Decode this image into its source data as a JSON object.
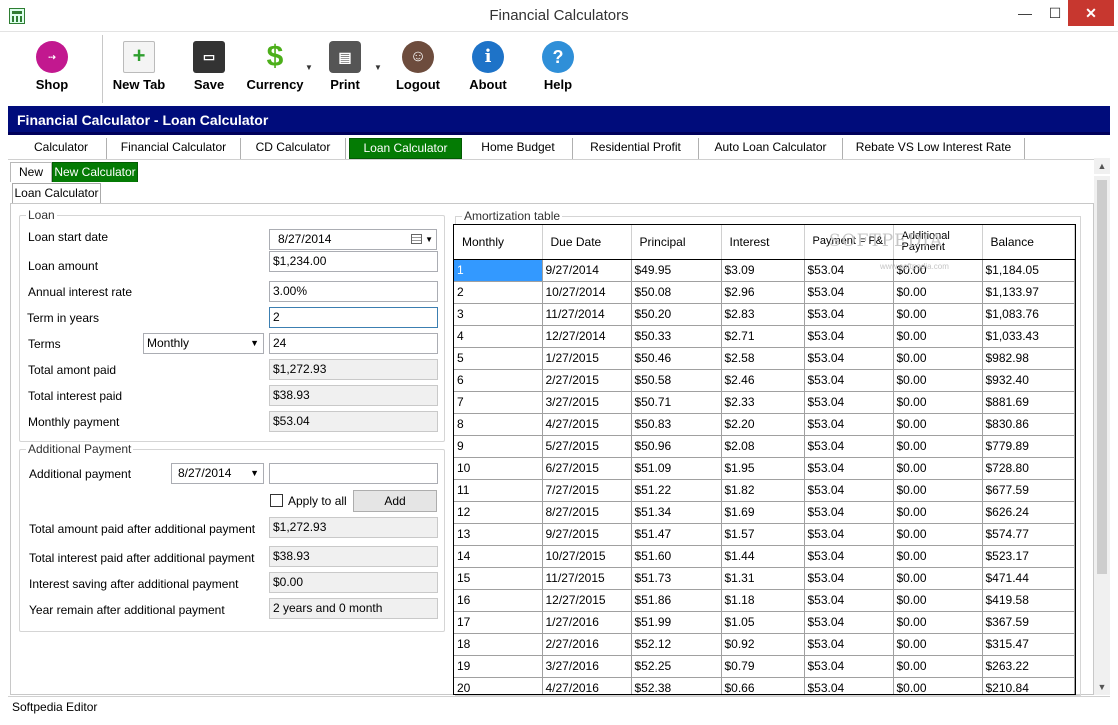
{
  "window": {
    "title": "Financial Calculators"
  },
  "toolbar": {
    "shop": "Shop",
    "new_tab": "New Tab",
    "save": "Save",
    "currency": "Currency",
    "print": "Print",
    "logout": "Logout",
    "about": "About",
    "help": "Help"
  },
  "header": {
    "title": "Financial Calculator - Loan Calculator"
  },
  "tabs": [
    "Calculator",
    "Financial Calculator",
    "CD Calculator",
    "Loan Calculator",
    "Home Budget",
    "Residential Profit",
    "Auto Loan Calculator",
    "Rebate VS Low Interest Rate"
  ],
  "subtabs": [
    "New",
    "New Calculator"
  ],
  "inner_tab": "Loan Calculator",
  "loan": {
    "legend": "Loan",
    "start_date_label": "Loan start date",
    "start_date": "8/27/2014",
    "amount_label": "Loan amount",
    "amount": "$1,234.00",
    "rate_label": "Annual interest rate",
    "rate": "3.00%",
    "term_label": "Term in years",
    "term": "2",
    "terms_label": "Terms",
    "terms_select": "Monthly",
    "terms_value": "24",
    "total_paid_label": "Total amont paid",
    "total_paid": "$1,272.93",
    "total_interest_label": "Total interest paid",
    "total_interest": "$38.93",
    "monthly_label": "Monthly payment",
    "monthly": "$53.04"
  },
  "additional": {
    "legend": "Additional Payment",
    "payment_label": "Additional payment",
    "date": "8/27/2014",
    "amount": "",
    "apply_all": "Apply to all",
    "add_button": "Add",
    "total_paid_label": "Total amount paid after additional payment",
    "total_paid": "$1,272.93",
    "total_interest_label": "Total interest paid after additional payment",
    "total_interest": "$38.93",
    "saving_label": "Interest saving after additional payment",
    "saving": "$0.00",
    "remain_label": "Year remain after additional payment",
    "remain": "2 years and 0 month"
  },
  "amortization": {
    "legend": "Amortization table",
    "columns": [
      "Monthly",
      "Due Date",
      "Principal",
      "Interest",
      "Payment = P&I",
      "Additional Payment",
      "Balance"
    ],
    "rows": [
      [
        "1",
        "9/27/2014",
        "$49.95",
        "$3.09",
        "$53.04",
        "$0.00",
        "$1,184.05"
      ],
      [
        "2",
        "10/27/2014",
        "$50.08",
        "$2.96",
        "$53.04",
        "$0.00",
        "$1,133.97"
      ],
      [
        "3",
        "11/27/2014",
        "$50.20",
        "$2.83",
        "$53.04",
        "$0.00",
        "$1,083.76"
      ],
      [
        "4",
        "12/27/2014",
        "$50.33",
        "$2.71",
        "$53.04",
        "$0.00",
        "$1,033.43"
      ],
      [
        "5",
        "1/27/2015",
        "$50.46",
        "$2.58",
        "$53.04",
        "$0.00",
        "$982.98"
      ],
      [
        "6",
        "2/27/2015",
        "$50.58",
        "$2.46",
        "$53.04",
        "$0.00",
        "$932.40"
      ],
      [
        "7",
        "3/27/2015",
        "$50.71",
        "$2.33",
        "$53.04",
        "$0.00",
        "$881.69"
      ],
      [
        "8",
        "4/27/2015",
        "$50.83",
        "$2.20",
        "$53.04",
        "$0.00",
        "$830.86"
      ],
      [
        "9",
        "5/27/2015",
        "$50.96",
        "$2.08",
        "$53.04",
        "$0.00",
        "$779.89"
      ],
      [
        "10",
        "6/27/2015",
        "$51.09",
        "$1.95",
        "$53.04",
        "$0.00",
        "$728.80"
      ],
      [
        "11",
        "7/27/2015",
        "$51.22",
        "$1.82",
        "$53.04",
        "$0.00",
        "$677.59"
      ],
      [
        "12",
        "8/27/2015",
        "$51.34",
        "$1.69",
        "$53.04",
        "$0.00",
        "$626.24"
      ],
      [
        "13",
        "9/27/2015",
        "$51.47",
        "$1.57",
        "$53.04",
        "$0.00",
        "$574.77"
      ],
      [
        "14",
        "10/27/2015",
        "$51.60",
        "$1.44",
        "$53.04",
        "$0.00",
        "$523.17"
      ],
      [
        "15",
        "11/27/2015",
        "$51.73",
        "$1.31",
        "$53.04",
        "$0.00",
        "$471.44"
      ],
      [
        "16",
        "12/27/2015",
        "$51.86",
        "$1.18",
        "$53.04",
        "$0.00",
        "$419.58"
      ],
      [
        "17",
        "1/27/2016",
        "$51.99",
        "$1.05",
        "$53.04",
        "$0.00",
        "$367.59"
      ],
      [
        "18",
        "2/27/2016",
        "$52.12",
        "$0.92",
        "$53.04",
        "$0.00",
        "$315.47"
      ],
      [
        "19",
        "3/27/2016",
        "$52.25",
        "$0.79",
        "$53.04",
        "$0.00",
        "$263.22"
      ],
      [
        "20",
        "4/27/2016",
        "$52.38",
        "$0.66",
        "$53.04",
        "$0.00",
        "$210.84"
      ]
    ],
    "watermark": "SOFTPEDIA",
    "watermark_sub": "www.softpedia.com"
  },
  "status": {
    "text": "Softpedia Editor"
  },
  "colors": {
    "header_bg": "#000c7b",
    "active_tab": "#047b04",
    "selection": "#3399ff",
    "close_btn": "#c7372f"
  }
}
